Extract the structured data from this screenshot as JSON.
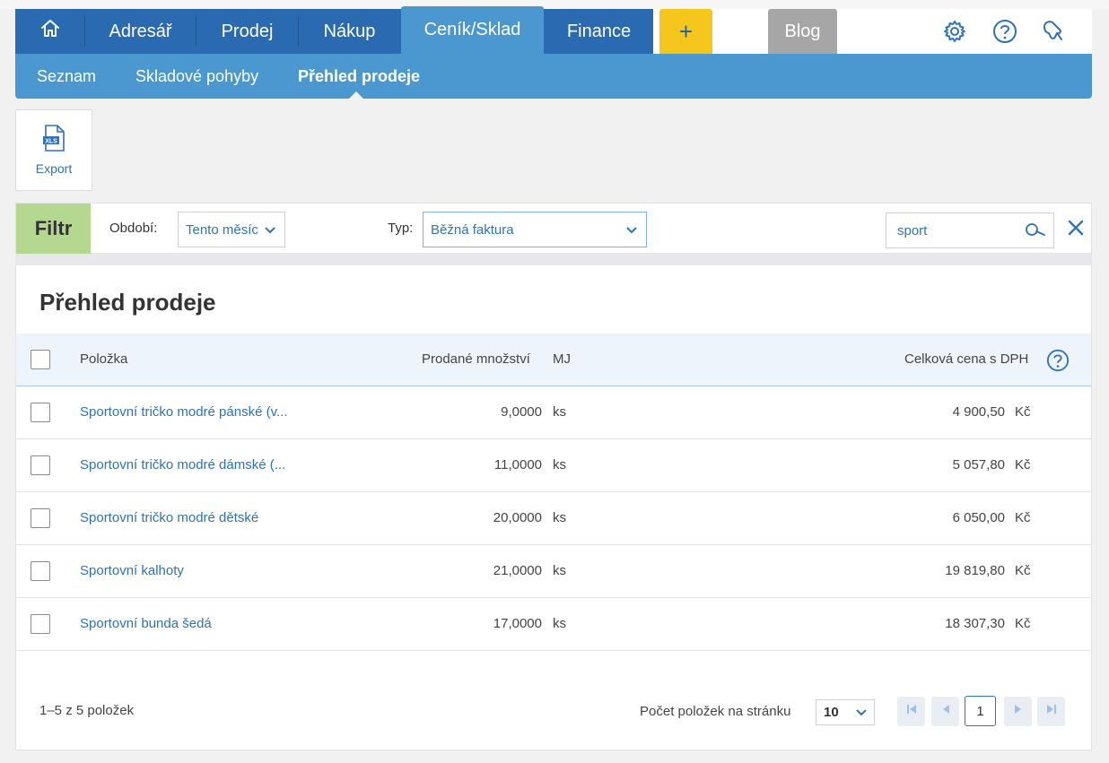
{
  "colors": {
    "nav_dark": "#2a6ab0",
    "nav_light": "#4b98d0",
    "accent_yellow": "#f5c71c",
    "filter_green": "#b4d88f",
    "link": "#2f72b8"
  },
  "nav": {
    "home_icon": "home-icon",
    "items": [
      "Adresář",
      "Prodej",
      "Nákup",
      "Ceník/Sklad",
      "Finance"
    ],
    "plus_label": "+",
    "blog_label": "Blog",
    "icons": [
      "gear-icon",
      "help-icon",
      "notification-icon"
    ]
  },
  "subnav": {
    "items": [
      "Seznam",
      "Skladové pohyby",
      "Přehled prodeje"
    ]
  },
  "toolbar": {
    "export_label": "Export",
    "export_icon": "xls-file-icon",
    "xls_badge": "XLS"
  },
  "filter": {
    "tag": "Filtr",
    "period_label": "Období:",
    "period_value": "Tento měsíc",
    "type_label": "Typ:",
    "type_value": "Běžná faktura",
    "search_value": "sport"
  },
  "main": {
    "title": "Přehled prodeje",
    "columns": [
      "Položka",
      "Prodané množství",
      "MJ",
      "Celková cena s DPH"
    ],
    "rows": [
      {
        "name": "Sportovní tričko modré pánské (v...",
        "qty": "9,0000",
        "unit": "ks",
        "price": "4 900,50",
        "currency": "Kč"
      },
      {
        "name": "Sportovní tričko modré dámské (...",
        "qty": "11,0000",
        "unit": "ks",
        "price": "5 057,80",
        "currency": "Kč"
      },
      {
        "name": "Sportovní tričko modré dětské",
        "qty": "20,0000",
        "unit": "ks",
        "price": "6 050,00",
        "currency": "Kč"
      },
      {
        "name": "Sportovní kalhoty",
        "qty": "21,0000",
        "unit": "ks",
        "price": "19 819,80",
        "currency": "Kč"
      },
      {
        "name": "Sportovní bunda šedá",
        "qty": "17,0000",
        "unit": "ks",
        "price": "18 307,30",
        "currency": "Kč"
      }
    ]
  },
  "footer": {
    "count_text": "1–5 z 5 položek",
    "per_page_label": "Počet položek na stránku",
    "per_page_value": "10",
    "current_page": "1"
  }
}
